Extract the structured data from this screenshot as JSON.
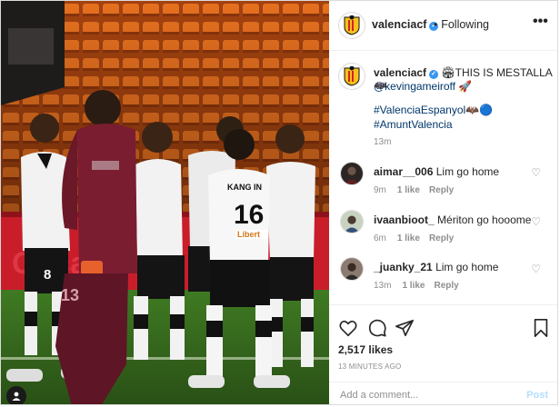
{
  "header": {
    "username": "valenciacf",
    "separator": "•",
    "follow_state": "Following",
    "more_label": "•••"
  },
  "caption": {
    "username": "valenciacf",
    "line1_emoji_a": "🏟",
    "line1_text": "THIS IS MESTALLA",
    "line1_emoji_b": "🦇",
    "line2_mention": "@kevingameiroff",
    "line2_emoji": "🚀",
    "line3_hashtag": "#ValenciaEspanyol",
    "line3_emoji": "🦇🔵",
    "line4_hashtag": "#AmuntValencia",
    "age": "13m"
  },
  "comments": [
    {
      "username": "aimar__006",
      "text": "Lim go home",
      "age": "9m",
      "likes": "1 like",
      "reply": "Reply"
    },
    {
      "username": "ivaanbioot_",
      "text": "Mériton go hooome",
      "age": "6m",
      "likes": "1 like",
      "reply": "Reply"
    },
    {
      "username": "_juanky_21",
      "text": "Lim go home",
      "age": "13m",
      "likes": "1 like",
      "reply": "Reply"
    }
  ],
  "actions": {
    "likes": "2,517 likes",
    "timestamp": "13 MINUTES AGO",
    "comment_placeholder": "Add a comment...",
    "post_label": "Post"
  },
  "photo": {
    "jersey_number_right": "16",
    "jersey_name_right": "KANG IN",
    "jersey_number_left": "8",
    "jersey_number_keeper": "13",
    "sponsor": "Libert"
  },
  "colors": {
    "link": "#00376b",
    "verified": "#3897f0",
    "muted": "#8e8e8e",
    "post_disabled": "#b2dffc",
    "stadium_orange": "#e0671c",
    "keeper_maroon": "#7a1d30"
  }
}
